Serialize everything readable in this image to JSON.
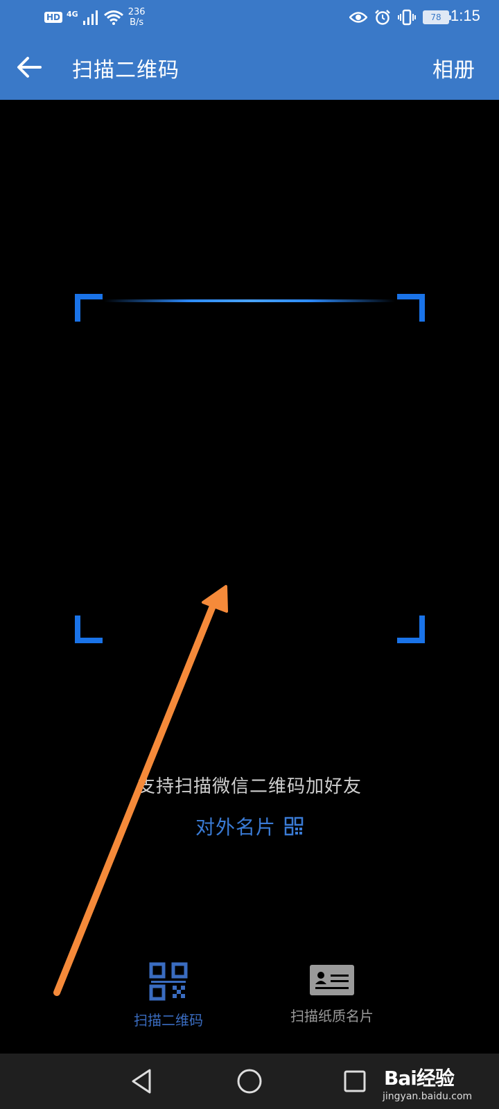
{
  "status_bar": {
    "hd": "HD",
    "network": "4G",
    "speed_value": "236",
    "speed_unit": "B/s",
    "battery": "78",
    "time": "1:15"
  },
  "header": {
    "title": "扫描二维码",
    "album_label": "相册"
  },
  "scanner": {
    "hint": "支持扫描微信二维码加好友",
    "card_link_label": "对外名片"
  },
  "modes": [
    {
      "label": "扫描二维码",
      "active": true
    },
    {
      "label": "扫描纸质名片",
      "active": false
    }
  ],
  "watermark": {
    "logo": "Bai经验",
    "url": "jingyan.baidu.com"
  },
  "colors": {
    "header_bg": "#3a79c8",
    "scan_frame": "#1a73e8",
    "link": "#3a7bd5",
    "annotation_arrow": "#f58a3a"
  }
}
